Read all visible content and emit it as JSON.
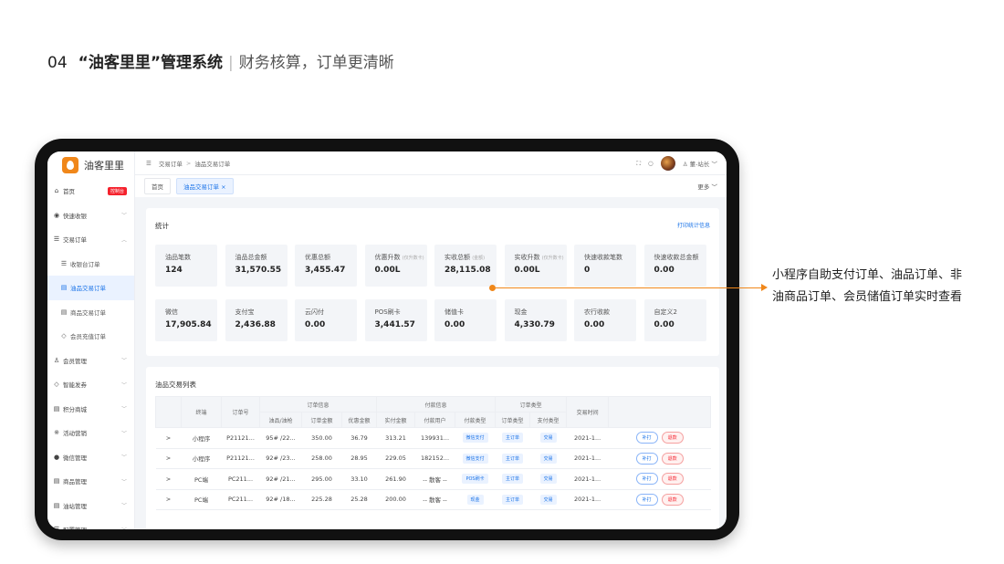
{
  "headline": {
    "number": "04",
    "bold": "“油客里里”管理系统",
    "sep": "|",
    "subtitle": "财务核算，订单更清晰"
  },
  "app": {
    "logo_text": "油客里里"
  },
  "sidebar": {
    "items": [
      {
        "icon": "⌂",
        "label": "首页",
        "badge": "控制台"
      },
      {
        "icon": "◉",
        "label": "快速收银",
        "chev": "﹀"
      },
      {
        "icon": "☰",
        "label": "交易订单",
        "chev": "︿"
      },
      {
        "icon": "☰",
        "label": "收银台订单",
        "sub": true
      },
      {
        "icon": "▤",
        "label": "油品交易订单",
        "sub": true,
        "active": true
      },
      {
        "icon": "▤",
        "label": "商品交易订单",
        "sub": true
      },
      {
        "icon": "◇",
        "label": "会员充值订单",
        "sub": true
      },
      {
        "icon": "♙",
        "label": "会员管理",
        "chev": "﹀"
      },
      {
        "icon": "◇",
        "label": "智能发券",
        "chev": "﹀"
      },
      {
        "icon": "▤",
        "label": "积分商城",
        "chev": "﹀"
      },
      {
        "icon": "※",
        "label": "活动营销",
        "chev": "﹀"
      },
      {
        "icon": "●",
        "label": "微信管理",
        "chev": "﹀"
      },
      {
        "icon": "▤",
        "label": "商品管理",
        "chev": "﹀"
      },
      {
        "icon": "▤",
        "label": "油站管理",
        "chev": "﹀"
      },
      {
        "icon": "☰",
        "label": "配置管理",
        "chev": "﹀"
      }
    ]
  },
  "topbar": {
    "menu_icon": "☰",
    "crumb1": "交易订单",
    "crumb_sep": ">",
    "crumb2": "油品交易订单",
    "user": "♙ 董-站长 ﹀"
  },
  "tabs": {
    "home": "首页",
    "active": "油品交易订单 ×",
    "more": "更多 ﹀"
  },
  "stats": {
    "title": "统计",
    "print": "打印统计信息",
    "row1": [
      {
        "label": "油品笔数",
        "note": "",
        "value": "124"
      },
      {
        "label": "油品总金额",
        "note": "",
        "value": "31,570.55"
      },
      {
        "label": "优惠总额",
        "note": "",
        "value": "3,455.47"
      },
      {
        "label": "优惠升数",
        "note": "(仅升数卡)",
        "value": "0.00L"
      },
      {
        "label": "实收总额",
        "note": "(金额)",
        "value": "28,115.08"
      },
      {
        "label": "实收升数",
        "note": "(仅升数卡)",
        "value": "0.00L"
      },
      {
        "label": "快速收款笔数",
        "note": "",
        "value": "0"
      },
      {
        "label": "快速收款总金额",
        "note": "",
        "value": "0.00"
      }
    ],
    "row2": [
      {
        "label": "微信",
        "note": "",
        "value": "17,905.84"
      },
      {
        "label": "支付宝",
        "note": "",
        "value": "2,436.88"
      },
      {
        "label": "云闪付",
        "note": "",
        "value": "0.00"
      },
      {
        "label": "POS刷卡",
        "note": "",
        "value": "3,441.57"
      },
      {
        "label": "储值卡",
        "note": "",
        "value": "0.00"
      },
      {
        "label": "现金",
        "note": "",
        "value": "4,330.79"
      },
      {
        "label": "农行收款",
        "note": "",
        "value": "0.00"
      },
      {
        "label": "自定义2",
        "note": "",
        "value": "0.00"
      }
    ]
  },
  "list": {
    "title": "油品交易列表",
    "groups": {
      "order_info": "订单信息",
      "pay_info": "付款信息",
      "order_type": "订单类型",
      "terminal": "终端",
      "order_no": "订单号",
      "time": "交易时间"
    },
    "columns": [
      "油品/油枪",
      "订单金额",
      "优惠金额",
      "实付金额",
      "付款用户",
      "付款类型",
      "订单类型",
      "支付类型"
    ],
    "rows": [
      {
        "terminal": "小程序",
        "no": "P21121...",
        "oil": "95# /22...",
        "amt": "350.00",
        "disc": "36.79",
        "paid": "313.21",
        "user": "139931...",
        "paytype": "微信支付",
        "otype": "主订单",
        "ptype": "交易",
        "time": "2021-1..."
      },
      {
        "terminal": "小程序",
        "no": "P21121...",
        "oil": "92# /23...",
        "amt": "258.00",
        "disc": "28.95",
        "paid": "229.05",
        "user": "182152...",
        "paytype": "微信支付",
        "otype": "主订单",
        "ptype": "交易",
        "time": "2021-1..."
      },
      {
        "terminal": "PC端",
        "no": "PC211...",
        "oil": "92# /21...",
        "amt": "295.00",
        "disc": "33.10",
        "paid": "261.90",
        "user": "-- 散客 --",
        "paytype": "POS刷卡",
        "otype": "主订单",
        "ptype": "交易",
        "time": "2021-1..."
      },
      {
        "terminal": "PC端",
        "no": "PC211...",
        "oil": "92# /18...",
        "amt": "225.28",
        "disc": "25.28",
        "paid": "200.00",
        "user": "-- 散客 --",
        "paytype": "现金",
        "otype": "主订单",
        "ptype": "交易",
        "time": "2021-1..."
      }
    ],
    "expand": ">",
    "btn_fill": "补打",
    "btn_refund": "退款"
  },
  "callout": {
    "line1": "小程序自助支付订单、油品订单、非",
    "line2": "油商品订单、会员储值订单实时查看"
  },
  "colors": {
    "accent": "#1a73e8",
    "brand": "#f0871a",
    "danger": "#f5222d"
  }
}
